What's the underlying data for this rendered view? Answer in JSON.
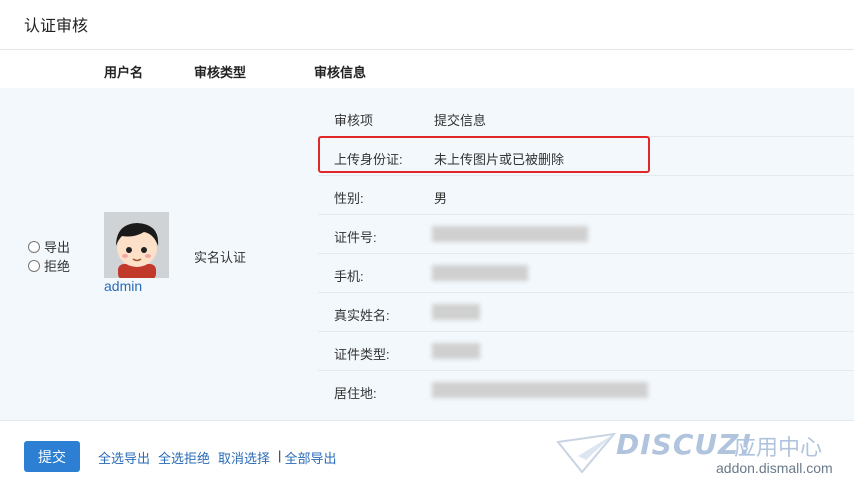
{
  "page": {
    "title": "认证审核"
  },
  "table_header": {
    "username": "用户名",
    "review_type": "审核类型",
    "review_info": "审核信息"
  },
  "row": {
    "options": [
      "导出",
      "拒绝"
    ],
    "username": "admin",
    "review_type": "实名认证",
    "info_header": {
      "label": "审核项",
      "value": "提交信息"
    },
    "fields": [
      {
        "label": "上传身份证:",
        "value": "未上传图片或已被删除"
      },
      {
        "label": "性别:",
        "value": "男"
      },
      {
        "label": "证件号:",
        "value": ""
      },
      {
        "label": "手机:",
        "value": ""
      },
      {
        "label": "真实姓名:",
        "value": ""
      },
      {
        "label": "证件类型:",
        "value": ""
      },
      {
        "label": "居住地:",
        "value": ""
      }
    ]
  },
  "footer": {
    "submit": "提交",
    "select_all_export": "全选导出",
    "select_all_reject": "全选拒绝",
    "cancel_selection": "取消选择",
    "separator": "|",
    "export_all": "全部导出"
  },
  "watermark": {
    "brand": "DISCUZ!",
    "cn": "应用中心",
    "url": "addon.dismall.com"
  },
  "colors": {
    "accent": "#2d7fd3",
    "link": "#2a6bb7",
    "row_bg": "#f2f8fc",
    "highlight": "#e02828"
  }
}
